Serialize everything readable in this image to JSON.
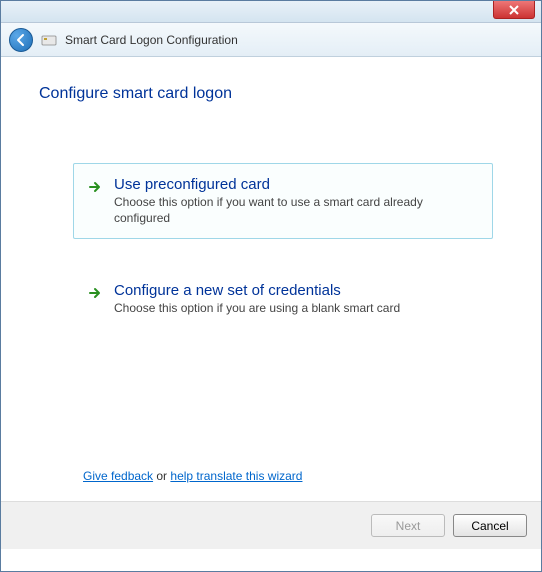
{
  "window": {
    "title": "Smart Card Logon Configuration"
  },
  "page": {
    "heading": "Configure smart card logon"
  },
  "options": {
    "preconfigured": {
      "title": "Use preconfigured card",
      "desc": "Choose this option if you want to use a smart card already configured"
    },
    "new_credentials": {
      "title": "Configure a new set of credentials",
      "desc": "Choose this option if you are using a blank smart card"
    }
  },
  "feedback": {
    "give": "Give fedback",
    "or": " or ",
    "translate": "help translate this wizard"
  },
  "buttons": {
    "next": "Next",
    "cancel": "Cancel"
  }
}
